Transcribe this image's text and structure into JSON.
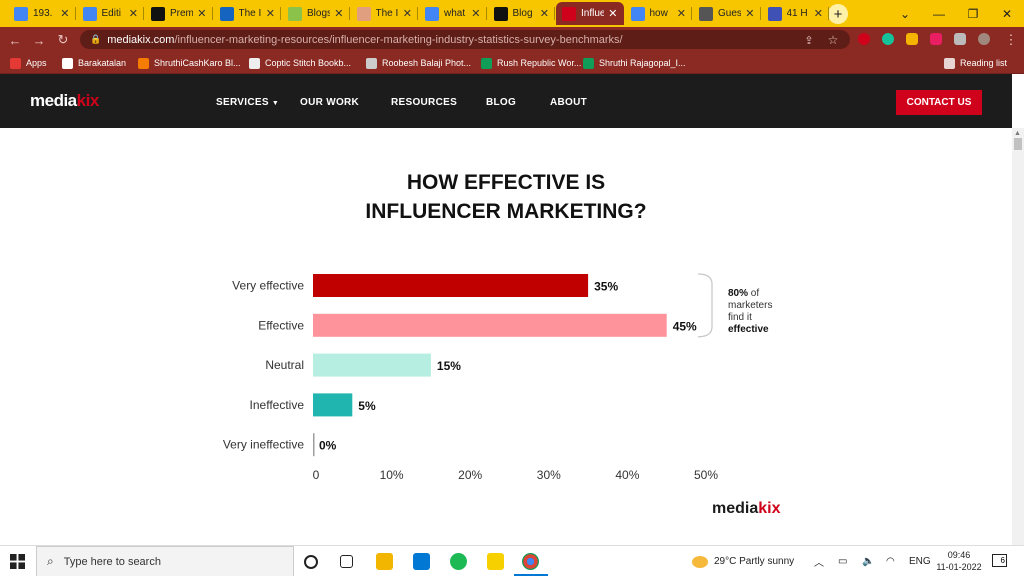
{
  "browser": {
    "tabs": [
      {
        "title": "193.",
        "icon_color": "#4285f4",
        "icon": "doc-icon"
      },
      {
        "title": "Editi",
        "icon_color": "#4285f4",
        "icon": "doc-icon"
      },
      {
        "title": "Prem",
        "icon_color": "#111111",
        "icon": "premiere-icon"
      },
      {
        "title": "The I",
        "icon_color": "#1565c0",
        "icon": "infinity-icon"
      },
      {
        "title": "Blogs",
        "icon_color": "#8bc34a",
        "icon": "circle-icon"
      },
      {
        "title": "The I",
        "icon_color": "#e0a080",
        "icon": "face-icon"
      },
      {
        "title": "what",
        "icon_color": "#4285f4",
        "icon": "google-icon"
      },
      {
        "title": "Blog",
        "icon_color": "#111111",
        "icon": "tag-icon"
      },
      {
        "title": "Influe",
        "icon_color": "#d0021b",
        "icon": "mediakix-icon",
        "active": true
      },
      {
        "title": "how",
        "icon_color": "#4285f4",
        "icon": "google-icon"
      },
      {
        "title": "Gues",
        "icon_color": "#555555",
        "icon": "globe-icon"
      },
      {
        "title": "41 H",
        "icon_color": "#3f51b5",
        "icon": "feather-icon"
      }
    ],
    "new_tab": "+",
    "window_controls": [
      "⌄",
      "—",
      "❐",
      "✕"
    ],
    "url_host": "mediakix.com",
    "url_path": "/influencer-marketing-resources/influencer-marketing-industry-statistics-survey-benchmarks/",
    "bookmarks": [
      {
        "label": "Apps",
        "color": "#e53935"
      },
      {
        "label": "Barakatalan",
        "color": "#ffffff"
      },
      {
        "label": "ShruthiCashKaro Bl...",
        "color": "#f57c00"
      },
      {
        "label": "Coptic Stitch Bookb...",
        "color": "#eeeeee"
      },
      {
        "label": "Roobesh Balaji Phot...",
        "color": "#cccccc"
      },
      {
        "label": "Rush Republic Wor...",
        "color": "#0f9d58"
      },
      {
        "label": "Shruthi Rajagopal_I...",
        "color": "#0f9d58"
      }
    ],
    "reading_list": "Reading list"
  },
  "site": {
    "logo_main": "media",
    "logo_accent": "kix",
    "nav": [
      "SERVICES",
      "OUR WORK",
      "RESOURCES",
      "BLOG",
      "ABOUT"
    ],
    "services_caret": "▼",
    "contact": "CONTACT US"
  },
  "chart_title_line1": "HOW EFFECTIVE IS",
  "chart_title_line2": "INFLUENCER MARKETING?",
  "chart_data": {
    "type": "bar",
    "title": "HOW EFFECTIVE IS INFLUENCER MARKETING?",
    "orientation": "horizontal",
    "categories": [
      "Very effective",
      "Effective",
      "Neutral",
      "Ineffective",
      "Very ineffective"
    ],
    "values": [
      35,
      45,
      15,
      5,
      0
    ],
    "value_labels": [
      "35%",
      "45%",
      "15%",
      "5%",
      "0%"
    ],
    "colors": [
      "#c00000",
      "#ff939b",
      "#b6eee2",
      "#21b5b0",
      "#9e9e9e"
    ],
    "xlim": [
      0,
      50
    ],
    "xticks": [
      "0",
      "10%",
      "20%",
      "30%",
      "40%",
      "50%"
    ],
    "grid": false,
    "annotation": {
      "bold1": "80%",
      "text1": " of",
      "text2": "marketers",
      "text3": "find it",
      "bold2": "effective"
    }
  },
  "chart_logo_main": "media",
  "chart_logo_accent": "kix",
  "taskbar": {
    "search_placeholder": "Type here to search",
    "weather_temp": "29°C",
    "weather_text": "Partly sunny",
    "lang": "ENG",
    "time": "09:46",
    "date": "11-01-2022",
    "notification_count": "6"
  }
}
